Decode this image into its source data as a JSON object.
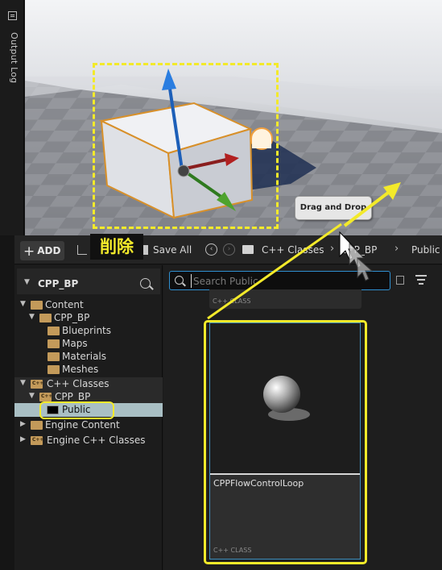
{
  "side_panel": {
    "output_log_label": "Output Log"
  },
  "annotations": {
    "drag_and_drop": "Drag and Drop",
    "delete": "削除"
  },
  "toolbar": {
    "add_label": "ADD",
    "save_all_label": "Save All",
    "breadcrumbs": [
      "C++ Classes",
      "CPP_BP",
      "Public"
    ]
  },
  "tree": {
    "title": "CPP_BP",
    "items": [
      {
        "label": "Content",
        "depth": 0,
        "expanded": true,
        "kind": "folder"
      },
      {
        "label": "CPP_BP",
        "depth": 1,
        "expanded": true,
        "kind": "folder"
      },
      {
        "label": "Blueprints",
        "depth": 2,
        "kind": "folder"
      },
      {
        "label": "Maps",
        "depth": 2,
        "kind": "folder"
      },
      {
        "label": "Materials",
        "depth": 2,
        "kind": "folder"
      },
      {
        "label": "Meshes",
        "depth": 2,
        "kind": "folder"
      },
      {
        "label": "C++ Classes",
        "depth": 0,
        "expanded": true,
        "kind": "cpp-folder"
      },
      {
        "label": "CPP_BP",
        "depth": 1,
        "expanded": true,
        "kind": "cpp-folder"
      },
      {
        "label": "Public",
        "depth": 2,
        "kind": "folder",
        "selected": true
      },
      {
        "label": "Engine Content",
        "depth": 0,
        "expanded": false,
        "kind": "folder"
      },
      {
        "label": "Engine C++ Classes",
        "depth": 0,
        "expanded": false,
        "kind": "cpp-folder"
      }
    ]
  },
  "search": {
    "placeholder": "Search Public",
    "value": ""
  },
  "assets": [
    {
      "class_label": "C++ CLASS"
    },
    {
      "name": "CPPFlowControlLoop",
      "class_label": "C++ CLASS"
    }
  ],
  "colors": {
    "annotation_yellow": "#f3ea2a",
    "selection": "#a9bfc4",
    "accent_blue": "#3d8fbf",
    "folder": "#c39a5a"
  }
}
